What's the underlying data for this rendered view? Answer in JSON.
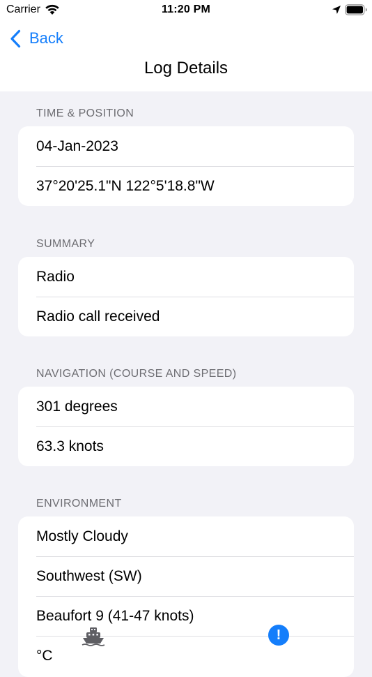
{
  "status_bar": {
    "carrier": "Carrier",
    "time": "11:20 PM"
  },
  "nav": {
    "back_label": "Back",
    "title": "Log Details"
  },
  "sections": [
    {
      "header": "TIME & POSITION",
      "rows": [
        "04-Jan-2023",
        "37°20'25.1\"N 122°5'18.8\"W"
      ]
    },
    {
      "header": "SUMMARY",
      "rows": [
        "Radio",
        "Radio call received"
      ]
    },
    {
      "header": "NAVIGATION (COURSE AND SPEED)",
      "rows": [
        "301 degrees",
        "63.3 knots"
      ]
    },
    {
      "header": "ENVIRONMENT",
      "rows": [
        "Mostly Cloudy",
        "Southwest (SW)",
        "Beaufort 9 (41-47 knots)",
        "°C"
      ]
    }
  ],
  "floating": {
    "alert_symbol": "!"
  },
  "colors": {
    "accent": "#147efb",
    "background": "#f2f2f7",
    "section_header": "#6d6d72"
  },
  "icons": [
    "wifi-icon",
    "location-arrow-icon",
    "battery-icon",
    "chevron-left-icon",
    "boat-icon",
    "alert-icon"
  ]
}
